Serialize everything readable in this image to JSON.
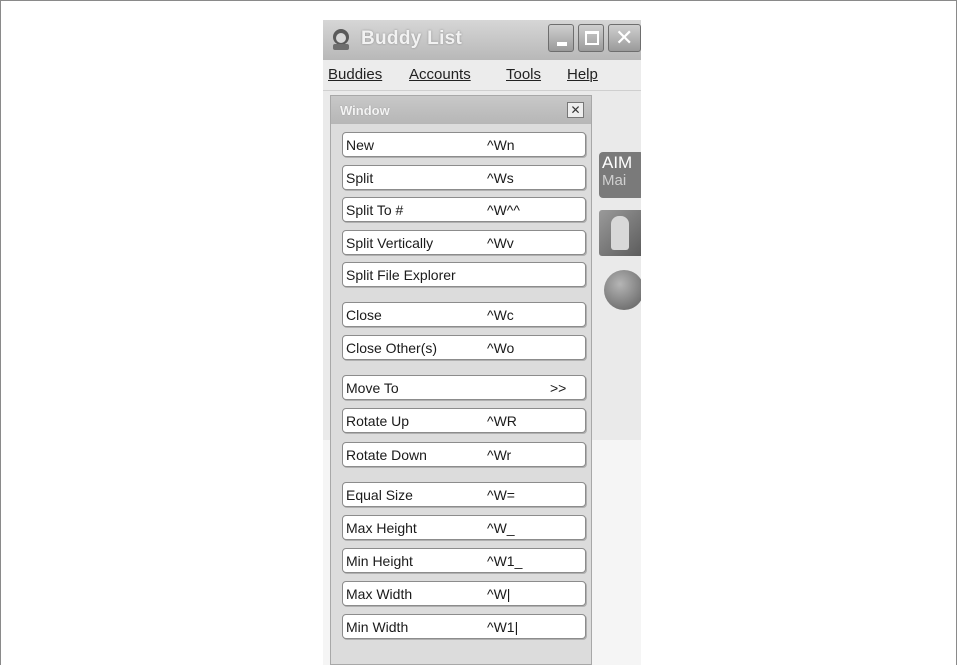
{
  "window": {
    "title": "Buddy List",
    "close_glyph": "✕"
  },
  "menubar": {
    "items": [
      "Buddies",
      "Accounts",
      "Tools",
      "Help"
    ]
  },
  "side_content": {
    "aim_line1": "AIM",
    "aim_line2": "Mai"
  },
  "panel": {
    "title": "Window",
    "close_glyph": "✕",
    "commands": [
      {
        "label": "New",
        "key": "^Wn"
      },
      {
        "label": "Split",
        "key": "^Ws"
      },
      {
        "label": "Split To #",
        "key": "^W^^"
      },
      {
        "label": "Split Vertically",
        "key": "^Wv"
      },
      {
        "label": "Split File Explorer",
        "key": ""
      },
      {
        "label": "Close",
        "key": "^Wc"
      },
      {
        "label": "Close Other(s)",
        "key": "^Wo"
      },
      {
        "label": "Move To",
        "key": ">>"
      },
      {
        "label": "Rotate Up",
        "key": "^WR"
      },
      {
        "label": "Rotate Down",
        "key": "^Wr"
      },
      {
        "label": "Equal Size",
        "key": "^W="
      },
      {
        "label": "Max Height",
        "key": "^W_"
      },
      {
        "label": "Min Height",
        "key": "^W1_"
      },
      {
        "label": "Max Width",
        "key": "^W|"
      },
      {
        "label": "Min Width",
        "key": "^W1|"
      }
    ]
  }
}
